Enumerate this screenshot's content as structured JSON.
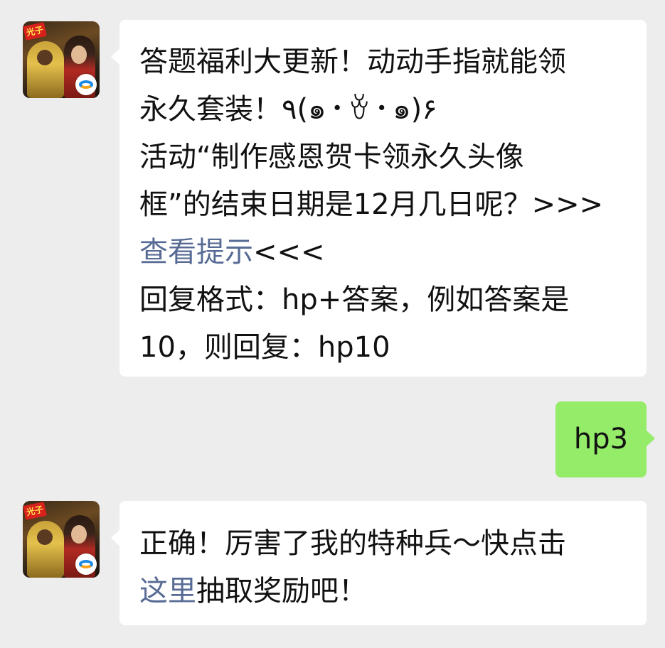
{
  "messages": [
    {
      "sender": "official-account",
      "avatar_tag": "光子",
      "lines": [
        "答题福利大更新！动动手指就能领",
        "永久套装！٩(๑・ꈊ・๑)۶",
        "活动“制作感恩贺卡领永久头像",
        "框”的结束日期是12月几日呢？>>>"
      ],
      "hint_link": "查看提示",
      "hint_suffix": "<<<",
      "format_lines": [
        "回复格式：hp+答案，例如答案是",
        "10，则回复：hp10"
      ]
    },
    {
      "sender": "me",
      "text": "hp3"
    },
    {
      "sender": "official-account",
      "avatar_tag": "光子",
      "line1": "正确！厉害了我的特种兵～快点击",
      "link": "这里",
      "suffix": "抽取奖励吧！"
    }
  ],
  "colors": {
    "background": "#ededed",
    "incoming_bubble": "#ffffff",
    "outgoing_bubble": "#95ec69",
    "link": "#576b95"
  }
}
